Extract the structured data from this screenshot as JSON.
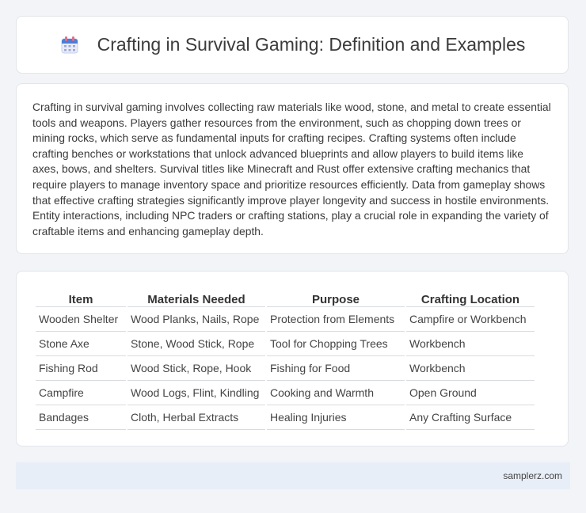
{
  "header": {
    "icon": "calendar-icon",
    "title": "Crafting in Survival Gaming: Definition and Examples"
  },
  "description": "Crafting in survival gaming involves collecting raw materials like wood, stone, and metal to create essential tools and weapons. Players gather resources from the environment, such as chopping down trees or mining rocks, which serve as fundamental inputs for crafting recipes. Crafting systems often include crafting benches or workstations that unlock advanced blueprints and allow players to build items like axes, bows, and shelters. Survival titles like Minecraft and Rust offer extensive crafting mechanics that require players to manage inventory space and prioritize resources efficiently. Data from gameplay shows that effective crafting strategies significantly improve player longevity and success in hostile environments. Entity interactions, including NPC traders or crafting stations, play a crucial role in expanding the variety of craftable items and enhancing gameplay depth.",
  "table": {
    "headers": [
      "Item",
      "Materials Needed",
      "Purpose",
      "Crafting Location"
    ],
    "rows": [
      [
        "Wooden Shelter",
        "Wood Planks, Nails, Rope",
        "Protection from Elements",
        "Campfire or Workbench"
      ],
      [
        "Stone Axe",
        "Stone, Wood Stick, Rope",
        "Tool for Chopping Trees",
        "Workbench"
      ],
      [
        "Fishing Rod",
        "Wood Stick, Rope, Hook",
        "Fishing for Food",
        "Workbench"
      ],
      [
        "Campfire",
        "Wood Logs, Flint, Kindling",
        "Cooking and Warmth",
        "Open Ground"
      ],
      [
        "Bandages",
        "Cloth, Herbal Extracts",
        "Healing Injuries",
        "Any Crafting Surface"
      ]
    ]
  },
  "footer": {
    "site": "samplerz.com"
  },
  "colors": {
    "icon_blue": "#4a7fd6",
    "icon_pink": "#e46c8c",
    "footer_bg": "#e8eef8"
  }
}
